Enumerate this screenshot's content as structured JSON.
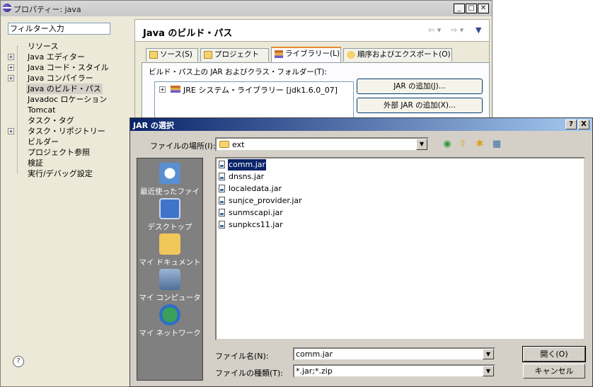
{
  "properties": {
    "title": "プロパティー: java",
    "filter_placeholder": "フィルター入力",
    "tree": [
      {
        "label": "リソース",
        "expandable": false
      },
      {
        "label": "Java エディター",
        "expandable": true
      },
      {
        "label": "Java コード・スタイル",
        "expandable": true
      },
      {
        "label": "Java コンパイラー",
        "expandable": true
      },
      {
        "label": "Java のビルド・パス",
        "expandable": false,
        "selected": true
      },
      {
        "label": "Javadoc ロケーション",
        "expandable": false
      },
      {
        "label": "Tomcat",
        "expandable": false
      },
      {
        "label": "タスク・タグ",
        "expandable": false
      },
      {
        "label": "タスク・リポジトリー",
        "expandable": true
      },
      {
        "label": "ビルダー",
        "expandable": false
      },
      {
        "label": "プロジェクト参照",
        "expandable": false
      },
      {
        "label": "検証",
        "expandable": false
      },
      {
        "label": "実行/デバッグ設定",
        "expandable": false
      }
    ],
    "page_title": "Java のビルド・パス",
    "tabs": [
      {
        "label": "ソース(S)",
        "active": false
      },
      {
        "label": "プロジェクト(P)",
        "active": false
      },
      {
        "label": "ライブラリー(L)",
        "active": true
      },
      {
        "label": "順序およびエクスポート(O)",
        "active": false
      }
    ],
    "library_label": "ビルド・パス上の JAR およびクラス・フォルダー(T):",
    "library_item": "JRE システム・ライブラリー [jdk1.6.0_07]",
    "add_jar": "JAR の追加(J)...",
    "add_external_jar": "外部 JAR の追加(X)..."
  },
  "dialog": {
    "title": "JAR の選択",
    "help_btn": "?",
    "close_btn": "X",
    "lookin_label": "ファイルの場所(I):",
    "lookin_value": "ext",
    "places": [
      {
        "label": "最近使ったファイル",
        "icon": "recent-files-icon",
        "color": "#5a8fd0"
      },
      {
        "label": "デスクトップ",
        "icon": "desktop-icon",
        "color": "#3f74c8"
      },
      {
        "label": "マイ ドキュメント",
        "icon": "my-documents-icon",
        "color": "#f0c75a"
      },
      {
        "label": "マイ コンピュータ",
        "icon": "my-computer-icon",
        "color": "#6f8fb4"
      },
      {
        "label": "マイ ネットワーク",
        "icon": "my-network-icon",
        "color": "#3aa05a"
      }
    ],
    "files": [
      {
        "name": "comm.jar",
        "selected": true
      },
      {
        "name": "dnsns.jar"
      },
      {
        "name": "localedata.jar"
      },
      {
        "name": "sunjce_provider.jar"
      },
      {
        "name": "sunmscapi.jar"
      },
      {
        "name": "sunpkcs11.jar"
      }
    ],
    "filename_label": "ファイル名(N):",
    "filename_value": "comm.jar",
    "filetype_label": "ファイルの種類(T):",
    "filetype_value": "*.jar;*.zip",
    "open_btn": "開く(O)",
    "cancel_btn": "キャンセル"
  },
  "colors": {
    "dialog_title_start": "#0a246a",
    "dialog_title_end": "#a6caf0",
    "selection": "#0a246a",
    "tab_accent": "#e68b2c"
  }
}
